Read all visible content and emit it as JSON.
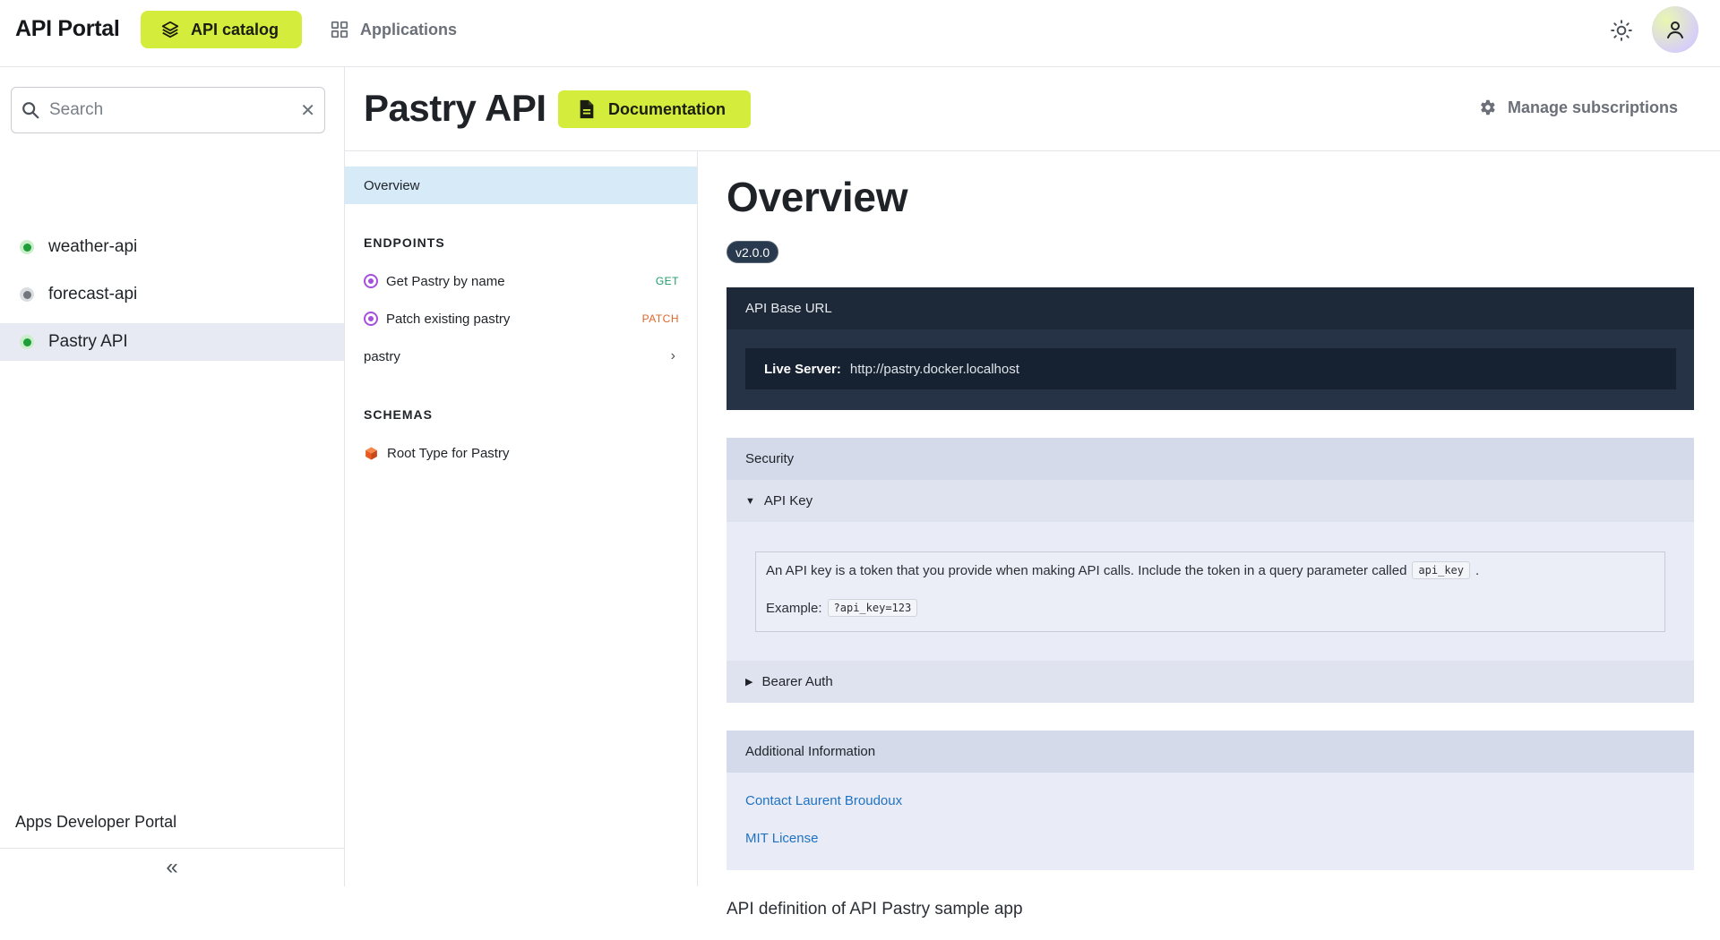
{
  "topbar": {
    "brand": "API Portal",
    "nav": [
      {
        "label": "API catalog",
        "icon": "layers-icon",
        "active": true
      },
      {
        "label": "Applications",
        "icon": "grid-icon",
        "active": false
      }
    ],
    "theme_icon": "sun-icon",
    "avatar_icon": "user-icon",
    "accent_color": "#d4ec3c"
  },
  "sidebar": {
    "search": {
      "placeholder": "Search",
      "value": ""
    },
    "apis": [
      {
        "label": "weather-api",
        "status": "green"
      },
      {
        "label": "forecast-api",
        "status": "grey"
      },
      {
        "label": "Pastry API",
        "status": "green",
        "selected": true
      }
    ],
    "footer_label": "Apps Developer Portal",
    "collapse_glyph": "«"
  },
  "header": {
    "title": "Pastry API",
    "doc_button": "Documentation",
    "manage_label": "Manage subscriptions"
  },
  "docnav": {
    "overview": "Overview",
    "endpoints_heading": "ENDPOINTS",
    "endpoints": [
      {
        "label": "Get Pastry by name",
        "method": "GET",
        "method_color": "#1f9e6a"
      },
      {
        "label": "Patch existing pastry",
        "method": "PATCH",
        "method_color": "#e0672a"
      },
      {
        "label": "pastry",
        "method": ""
      }
    ],
    "schemas_heading": "SCHEMAS",
    "schemas": [
      {
        "label": "Root Type for Pastry"
      }
    ]
  },
  "content": {
    "title": "Overview",
    "version": "v2.0.0",
    "base_url": {
      "heading": "API Base URL",
      "server_label": "Live Server:",
      "server_url": "http://pastry.docker.localhost"
    },
    "security": {
      "heading": "Security",
      "api_key": {
        "label": "API Key",
        "desc": "An API key is a token that you provide when making API calls. Include the token in a query parameter called",
        "param": "api_key",
        "example_label": "Example:",
        "example_value": "?api_key=123"
      },
      "bearer_label": "Bearer Auth"
    },
    "additional": {
      "heading": "Additional Information",
      "links": [
        "Contact Laurent Broudoux",
        "MIT License"
      ]
    },
    "description": "API definition of API Pastry sample app"
  }
}
